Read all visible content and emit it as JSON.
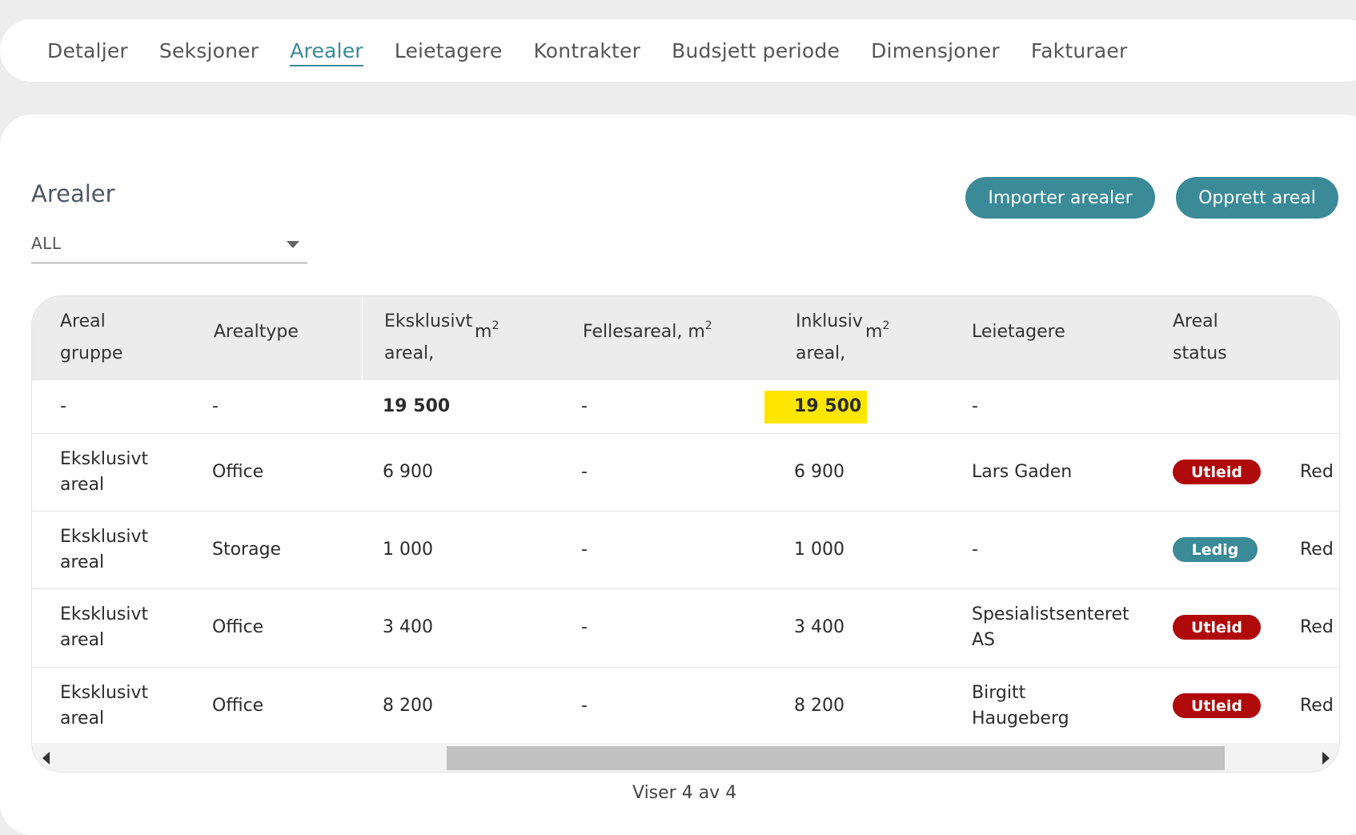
{
  "tabs": [
    {
      "label": "Detaljer"
    },
    {
      "label": "Seksjoner"
    },
    {
      "label": "Arealer"
    },
    {
      "label": "Leietagere"
    },
    {
      "label": "Kontrakter"
    },
    {
      "label": "Budsjett periode"
    },
    {
      "label": "Dimensjoner"
    },
    {
      "label": "Fakturaer"
    }
  ],
  "active_tab": "Arealer",
  "section": {
    "title": "Arealer",
    "filter_value": "ALL",
    "import_button": "Importer arealer",
    "create_button": "Opprett areal"
  },
  "table": {
    "headers": {
      "group_line1": "Areal",
      "group_line2": "gruppe",
      "type": "Arealtype",
      "exclusive_line1": "Eksklusivt",
      "exclusive_line2": "areal,",
      "exclusive_unit": "m",
      "exclusive_sup": "2",
      "common": "Fellesareal, m",
      "common_sup": "2",
      "inclusive_line1": "Inklusiv",
      "inclusive_line2": "areal,",
      "inclusive_unit": "m",
      "inclusive_sup": "2",
      "tenants": "Leietagere",
      "status_line1": "Areal",
      "status_line2": "status"
    },
    "summary": {
      "group": "-",
      "type": "-",
      "exclusive": "19 500",
      "common": "-",
      "inclusive": "19 500",
      "tenants": "-"
    },
    "rows": [
      {
        "group1": "Eksklusivt",
        "group2": "areal",
        "type": "Office",
        "exclusive": "6 900",
        "common": "-",
        "inclusive": "6 900",
        "tenant1": "Lars Gaden",
        "tenant2": "",
        "status": "Utleid",
        "action": "Red"
      },
      {
        "group1": "Eksklusivt",
        "group2": "areal",
        "type": "Storage",
        "exclusive": "1 000",
        "common": "-",
        "inclusive": "1 000",
        "tenant1": "-",
        "tenant2": "",
        "status": "Ledig",
        "action": "Red"
      },
      {
        "group1": "Eksklusivt",
        "group2": "areal",
        "type": "Office",
        "exclusive": "3 400",
        "common": "-",
        "inclusive": "3 400",
        "tenant1": "Spesialistsenteret",
        "tenant2": "AS",
        "status": "Utleid",
        "action": "Red"
      },
      {
        "group1": "Eksklusivt",
        "group2": "areal",
        "type": "Office",
        "exclusive": "8 200",
        "common": "-",
        "inclusive": "8 200",
        "tenant1": "Birgitt",
        "tenant2": "Haugeberg",
        "status": "Utleid",
        "action": "Red"
      }
    ]
  },
  "footer": {
    "text": "Viser 4 av 4"
  },
  "colors": {
    "accent": "#3a8a98",
    "rented": "#b0090a",
    "highlight": "#ffe600"
  }
}
